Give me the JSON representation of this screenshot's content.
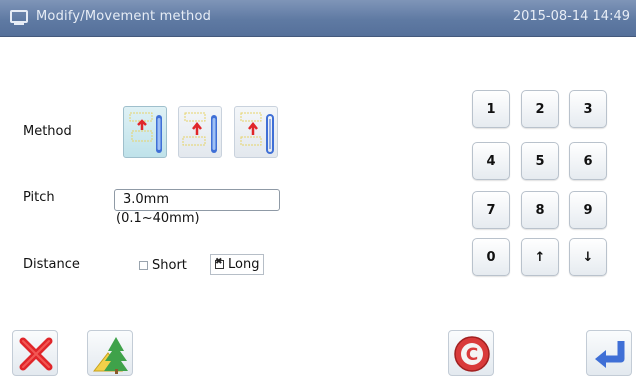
{
  "titlebar": {
    "title": "Modify/Movement method",
    "datetime": "2015-08-14 14:49",
    "icon": "screen-icon"
  },
  "method": {
    "label": "Method",
    "options": [
      {
        "icon": "method-vertical-icon",
        "selected": true
      },
      {
        "icon": "method-shift-icon",
        "selected": false
      },
      {
        "icon": "method-needle-icon",
        "selected": false
      }
    ]
  },
  "pitch": {
    "label": "Pitch",
    "value": "3.0mm",
    "range": "(0.1~40mm)"
  },
  "distance": {
    "label": "Distance",
    "options": [
      {
        "label": "Short",
        "checked": false
      },
      {
        "label": "Long",
        "checked": true
      }
    ]
  },
  "keypad": {
    "keys": [
      "1",
      "2",
      "3",
      "4",
      "5",
      "6",
      "7",
      "8",
      "9",
      "0",
      "↑",
      "↓"
    ]
  },
  "bottom": {
    "cancel_icon": "close-icon",
    "pattern_icon": "tree-pattern-icon",
    "clear_icon": "clear-c-icon",
    "enter_icon": "enter-icon"
  },
  "colors": {
    "titlebar": "#5f7aa3",
    "accent_blue": "#3f6fd6",
    "cancel_red": "#e0262a"
  }
}
